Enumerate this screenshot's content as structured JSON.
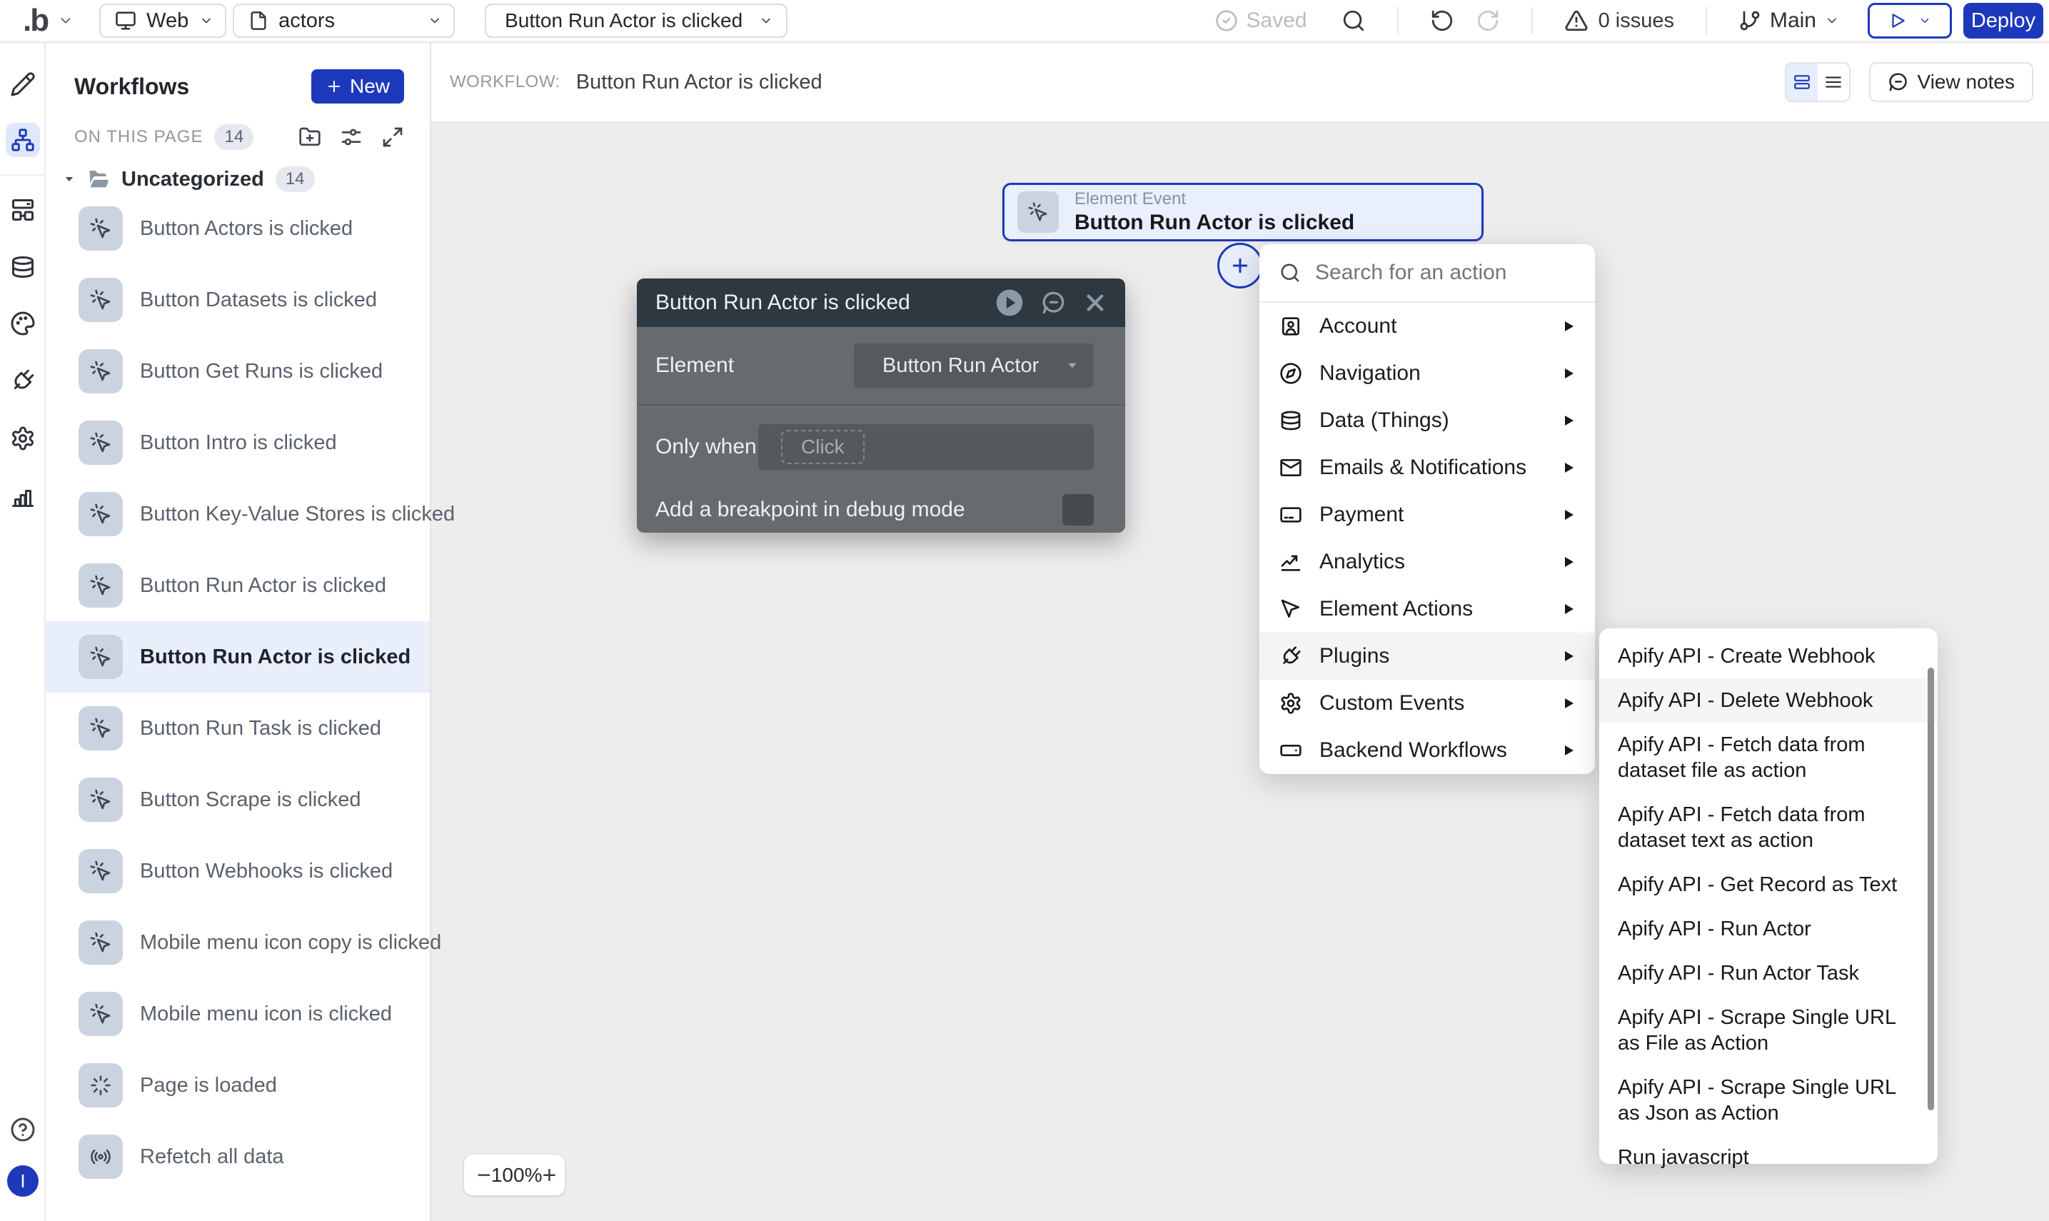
{
  "topbar": {
    "logo": ".b",
    "platform": {
      "label": "Web"
    },
    "page_select": {
      "label": "actors"
    },
    "workflow_select": {
      "label": "Button Run Actor is clicked"
    },
    "saved_label": "Saved",
    "issues_label": "0 issues",
    "branch_label": "Main",
    "deploy_label": "Deploy"
  },
  "rail": {
    "icons": [
      "design-pencil",
      "workflows-tree",
      "components-blocks",
      "database",
      "styles-palette",
      "plugins-plug",
      "settings-gear",
      "logs-chart",
      "help",
      "avatar"
    ],
    "avatar_initial": "I",
    "active_item": "workflows-tree"
  },
  "workflows": {
    "title": "Workflows",
    "new_button": "New",
    "on_this_page": "ON THIS PAGE",
    "on_this_page_count": "14",
    "folder": {
      "name": "Uncategorized",
      "count": "14"
    },
    "items": [
      {
        "label": "Button Actors is clicked",
        "icon": "mouse-click",
        "selected": false
      },
      {
        "label": "Button Datasets is clicked",
        "icon": "mouse-click",
        "selected": false
      },
      {
        "label": "Button Get Runs is clicked",
        "icon": "mouse-click",
        "selected": false
      },
      {
        "label": "Button Intro is clicked",
        "icon": "mouse-click",
        "selected": false
      },
      {
        "label": "Button Key-Value Stores is clicked",
        "icon": "mouse-click",
        "selected": false
      },
      {
        "label": "Button Run Actor is clicked",
        "icon": "mouse-click",
        "selected": false
      },
      {
        "label": "Button Run Actor is clicked",
        "icon": "mouse-click",
        "selected": true
      },
      {
        "label": "Button Run Task is clicked",
        "icon": "mouse-click",
        "selected": false
      },
      {
        "label": "Button Scrape is clicked",
        "icon": "mouse-click",
        "selected": false
      },
      {
        "label": "Button Webhooks is clicked",
        "icon": "mouse-click",
        "selected": false
      },
      {
        "label": "Mobile menu icon copy is clicked",
        "icon": "mouse-click",
        "selected": false
      },
      {
        "label": "Mobile menu icon is clicked",
        "icon": "mouse-click",
        "selected": false
      },
      {
        "label": "Page is loaded",
        "icon": "page-load-burst",
        "selected": false
      },
      {
        "label": "Refetch all data",
        "icon": "broadcast",
        "selected": false
      }
    ]
  },
  "canvas": {
    "workflow_label": "WORKFLOW:",
    "workflow_name": "Button Run Actor is clicked",
    "view_notes_label": "View notes",
    "node": {
      "type_label": "Element Event",
      "title": "Button Run Actor is clicked"
    },
    "zoom": {
      "minus": "−",
      "level": "100%",
      "plus": "+"
    }
  },
  "dialog": {
    "title": "Button Run Actor is clicked",
    "element_label": "Element",
    "element_value": "Button Run Actor",
    "only_when_label": "Only when",
    "only_when_placeholder": "Click",
    "breakpoint_label": "Add a breakpoint in debug mode"
  },
  "action_menu": {
    "search_placeholder": "Search for an action",
    "items": [
      {
        "label": "Account",
        "icon": "account-card"
      },
      {
        "label": "Navigation",
        "icon": "compass"
      },
      {
        "label": "Data (Things)",
        "icon": "database"
      },
      {
        "label": "Emails & Notifications",
        "icon": "envelope"
      },
      {
        "label": "Payment",
        "icon": "credit-card"
      },
      {
        "label": "Analytics",
        "icon": "trend-chart"
      },
      {
        "label": "Element Actions",
        "icon": "cursor-pointer"
      },
      {
        "label": "Plugins",
        "icon": "plug",
        "hover": true
      },
      {
        "label": "Custom Events",
        "icon": "gear"
      },
      {
        "label": "Backend Workflows",
        "icon": "window-input"
      }
    ]
  },
  "submenu": {
    "items": [
      {
        "label": "Apify API - Create Webhook"
      },
      {
        "label": "Apify API - Delete Webhook",
        "hover": true
      },
      {
        "label": "Apify API - Fetch data from dataset file as action"
      },
      {
        "label": "Apify API - Fetch data from dataset text as action"
      },
      {
        "label": "Apify API - Get Record as Text"
      },
      {
        "label": "Apify API - Run Actor"
      },
      {
        "label": "Apify API - Run Actor Task"
      },
      {
        "label": "Apify API - Scrape Single URL as File as Action"
      },
      {
        "label": "Apify API - Scrape Single URL as Json as Action"
      },
      {
        "label": "Run javascript"
      }
    ]
  },
  "colors": {
    "accent": "#1d39bb",
    "node_bg": "#e9effc",
    "selected_row": "#e9eefb",
    "canvas": "#ededee",
    "dialog_header": "#2d3840",
    "dialog_body": "#666b6f"
  }
}
